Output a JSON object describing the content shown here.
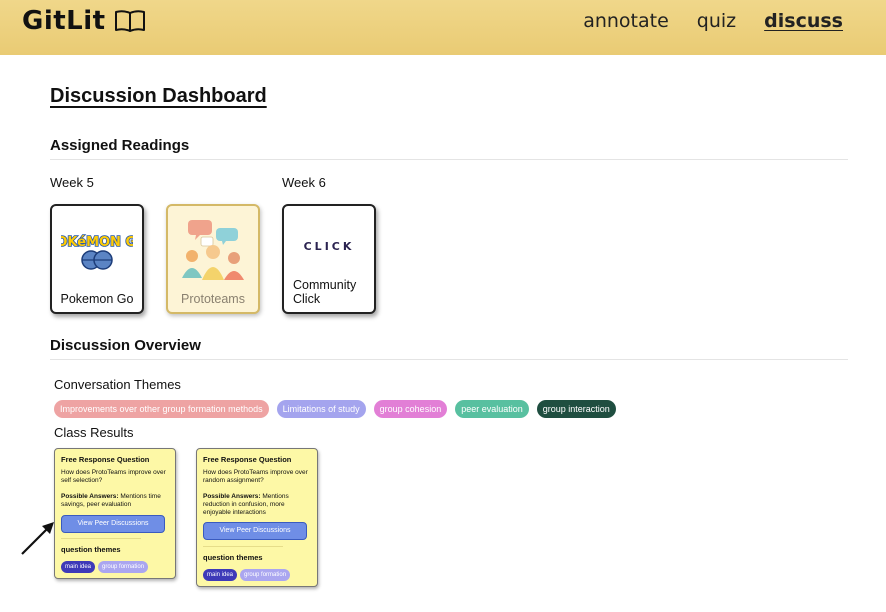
{
  "app": {
    "name": "GitLit"
  },
  "nav": {
    "annotate": "annotate",
    "quiz": "quiz",
    "discuss": "discuss"
  },
  "page": {
    "title": "Discussion Dashboard"
  },
  "readings": {
    "heading": "Assigned Readings",
    "week5": "Week 5",
    "week6": "Week 6",
    "items": [
      {
        "label": "Pokemon Go",
        "logo_text": "POKéMON GO"
      },
      {
        "label": "Prototeams"
      },
      {
        "label": "Community Click",
        "logo_text": "CLICK"
      }
    ]
  },
  "overview": {
    "heading": "Discussion Overview",
    "themes_heading": "Conversation Themes",
    "themes": [
      {
        "label": "Improvements over other group formation methods",
        "color": "#eea3a3"
      },
      {
        "label": "Limitations of study",
        "color": "#a4a4ee"
      },
      {
        "label": "group cohesion",
        "color": "#e27fd6"
      },
      {
        "label": "peer evaluation",
        "color": "#58c0a0"
      },
      {
        "label": "group interaction",
        "color": "#1f4e40"
      }
    ],
    "results_heading": "Class Results",
    "results": [
      {
        "title": "Free Response Question",
        "question": "How does ProtoTeams improve over self selection?",
        "answers_label": "Possible Answers:",
        "answers": "Mentions time savings, peer evaluation",
        "button": "View Peer Discussions",
        "themes_label": "question themes",
        "tags": [
          {
            "label": "main idea",
            "color": "#3e3ab8"
          },
          {
            "label": "group formation",
            "color": "#aaa6f0"
          }
        ]
      },
      {
        "title": "Free Response Question",
        "question": "How does ProtoTeams improve over random assignment?",
        "answers_label": "Possible Answers:",
        "answers": "Mentions reduction in confusion, more enjoyable interactions",
        "button": "View Peer Discussions",
        "themes_label": "question themes",
        "tags": [
          {
            "label": "main idea",
            "color": "#3e3ab8"
          },
          {
            "label": "group formation",
            "color": "#aaa6f0"
          }
        ]
      }
    ]
  }
}
